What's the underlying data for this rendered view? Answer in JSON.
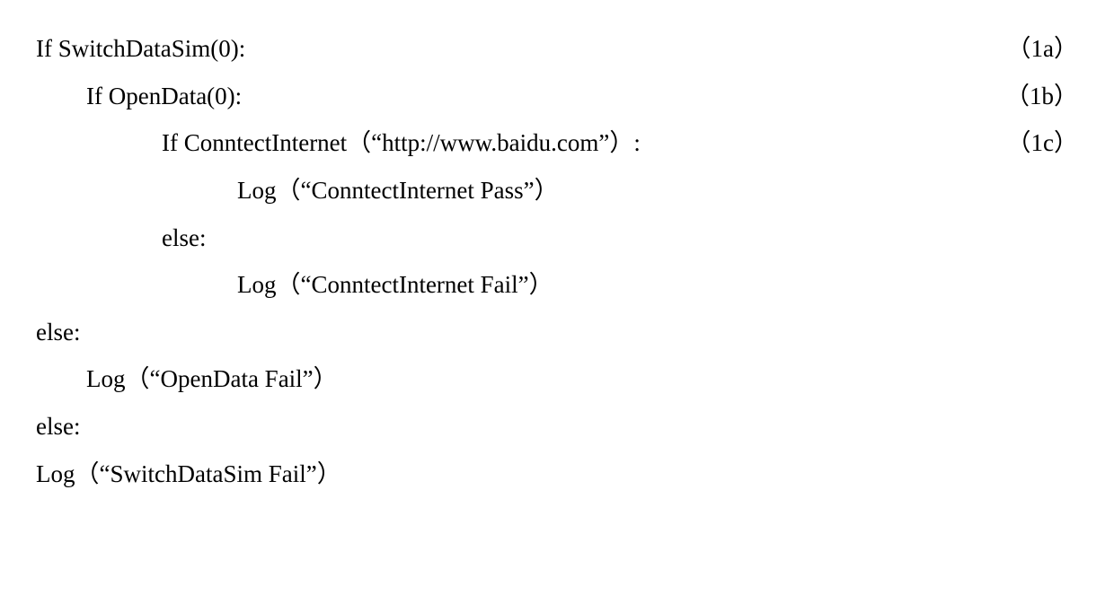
{
  "lines": [
    {
      "indent": "i0",
      "text": "If SwitchDataSim(0):",
      "num": "（1a）"
    },
    {
      "indent": "i1",
      "text": "If OpenData(0):",
      "num": "（1b）"
    },
    {
      "indent": "i2",
      "text": "If ConntectInternet（“http://www.baidu.com”）:",
      "num": "（1c）"
    },
    {
      "indent": "i3",
      "text": "Log（“ConntectInternet Pass”）",
      "num": ""
    },
    {
      "indent": "i2",
      "text": "else:",
      "num": ""
    },
    {
      "indent": "i3",
      "text": "Log（“ConntectInternet Fail”）",
      "num": ""
    },
    {
      "indent": "i0",
      "text": "else:",
      "num": ""
    },
    {
      "indent": "i0b",
      "text": "Log（“OpenData Fail”）",
      "num": ""
    },
    {
      "indent": "i0",
      "text": "else:",
      "num": ""
    },
    {
      "indent": "i0",
      "text": "Log（“SwitchDataSim Fail”）",
      "num": ""
    }
  ]
}
